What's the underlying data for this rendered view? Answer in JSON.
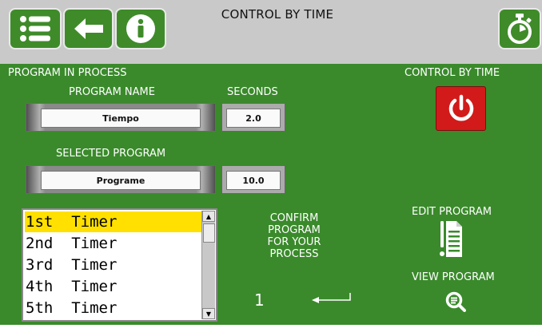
{
  "header": {
    "title": "CONTROL BY TIME"
  },
  "toolbar": {
    "menu_icon": "list-icon",
    "back_icon": "arrow-left-icon",
    "info_icon": "info-icon",
    "timer_icon": "stopwatch-icon"
  },
  "program_section": {
    "heading": "PROGRAM IN PROCESS",
    "name_label": "PROGRAM NAME",
    "seconds_label": "SECONDS",
    "program_name": "Tiempo",
    "seconds_value": "2.0",
    "selected_label": "SELECTED PROGRAM",
    "selected_name": "Programe",
    "selected_value": "10.0"
  },
  "control": {
    "label": "CONTROL BY TIME",
    "icon": "power-icon",
    "color": "#d21a1a"
  },
  "timer_list": {
    "items": [
      "1st  Timer",
      "2nd  Timer",
      "3rd  Timer",
      "4th  Timer",
      "5th  Timer"
    ],
    "selected_index": 0,
    "highlight_color": "#ffe000"
  },
  "confirm": {
    "line1": "CONFIRM",
    "line2": "PROGRAM",
    "line3": "FOR YOUR",
    "line4": "PROCESS",
    "value": "1",
    "enter_icon": "enter-arrow-icon"
  },
  "edit": {
    "label": "EDIT PROGRAM",
    "icon": "document-icon"
  },
  "view": {
    "label": "VIEW PROGRAM",
    "icon": "magnifier-icon"
  },
  "theme": {
    "panel_color": "#3a8a2b",
    "header_color": "#c9c9c9"
  }
}
